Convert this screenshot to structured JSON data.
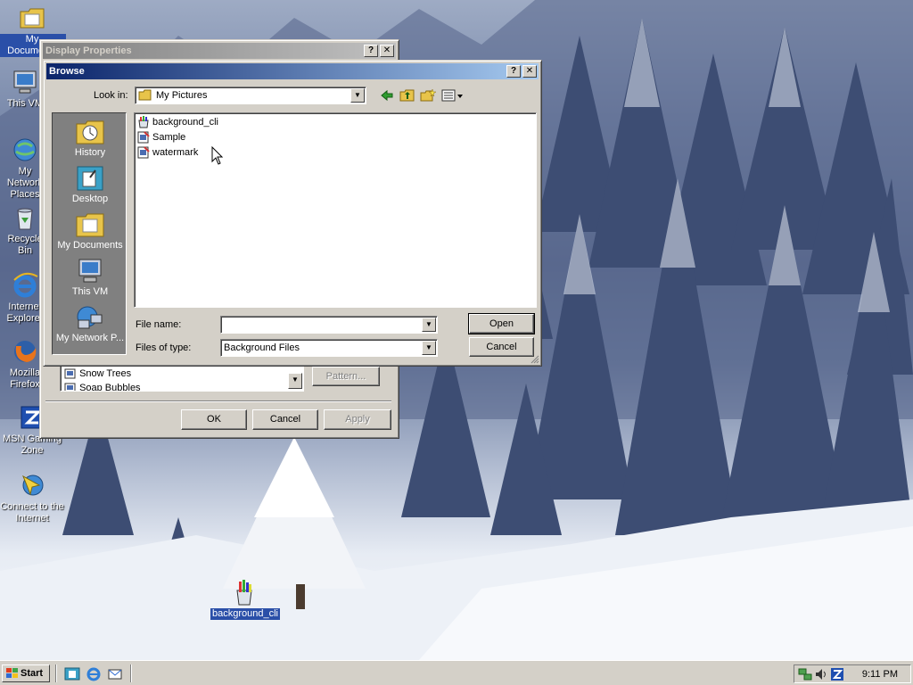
{
  "desktop": {
    "icons": [
      {
        "name": "my-documents",
        "label": "My Documents",
        "selected": true
      },
      {
        "name": "this-vm",
        "label": "This VM"
      },
      {
        "name": "my-network-places",
        "label": "My Network Places"
      },
      {
        "name": "recycle-bin",
        "label": "Recycle Bin"
      },
      {
        "name": "internet-explorer",
        "label": "Internet Explorer"
      },
      {
        "name": "mozilla-firefox",
        "label": "Mozilla Firefox"
      },
      {
        "name": "msn-gaming-zone",
        "label": "MSN Gaming Zone"
      },
      {
        "name": "connect-to-the-internet",
        "label": "Connect to the Internet"
      },
      {
        "name": "background-cli",
        "label": "background_cli",
        "selected": true
      }
    ]
  },
  "display_properties": {
    "title": "Display Properties",
    "help_label": "?",
    "close_label": "✕",
    "wallpaper_items": [
      "Snow Trees",
      "Soap Bubbles"
    ],
    "pattern_label": "Pattern...",
    "ok_label": "OK",
    "cancel_label": "Cancel",
    "apply_label": "Apply"
  },
  "browse": {
    "title": "Browse",
    "help_label": "?",
    "close_label": "✕",
    "look_in_label": "Look in:",
    "look_in_value": "My Pictures",
    "places": [
      {
        "name": "history",
        "label": "History"
      },
      {
        "name": "desktop",
        "label": "Desktop"
      },
      {
        "name": "my-documents",
        "label": "My Documents"
      },
      {
        "name": "this-vm",
        "label": "This VM"
      },
      {
        "name": "my-network-places",
        "label": "My Network P..."
      }
    ],
    "files": [
      "background_cli",
      "Sample",
      "watermark"
    ],
    "file_name_label": "File name:",
    "file_name_value": "",
    "files_of_type_label": "Files of type:",
    "files_of_type_value": "Background Files",
    "open_label": "Open",
    "cancel_label": "Cancel"
  },
  "taskbar": {
    "start_label": "Start",
    "clock": "9:11 PM"
  },
  "colors": {
    "titlebar_active": "#0a246a",
    "titlebar_inactive": "#808080",
    "face": "#d4d0c8"
  }
}
